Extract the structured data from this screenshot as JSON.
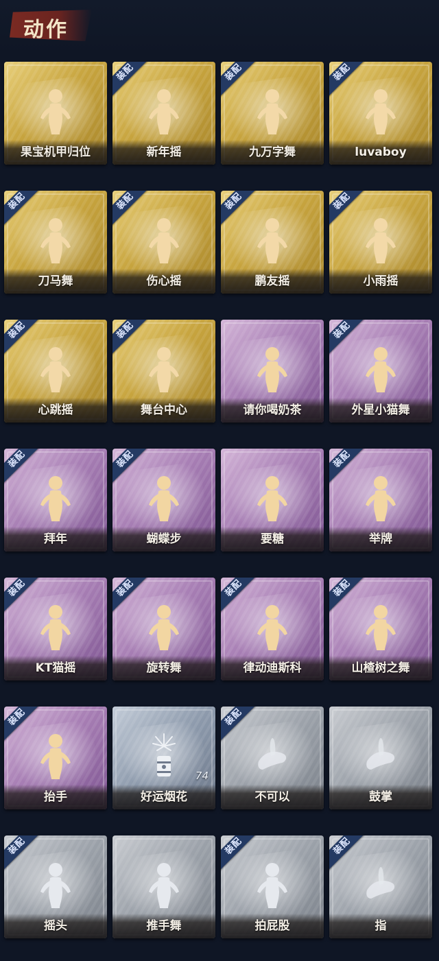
{
  "header": {
    "title": "动作"
  },
  "badge_text": "装配",
  "cards": [
    {
      "label": "果宝机甲归位",
      "tier": "gold",
      "equipped": false,
      "icon": "dance-figure-icon"
    },
    {
      "label": "新年摇",
      "tier": "gold",
      "equipped": true,
      "icon": "dance-figure-icon"
    },
    {
      "label": "九万字舞",
      "tier": "gold",
      "equipped": true,
      "icon": "dance-figure-icon"
    },
    {
      "label": "luvaboy",
      "tier": "gold",
      "equipped": true,
      "icon": "dance-figure-icon"
    },
    {
      "label": "刀马舞",
      "tier": "gold",
      "equipped": true,
      "icon": "dance-figure-icon"
    },
    {
      "label": "伤心摇",
      "tier": "gold",
      "equipped": true,
      "icon": "heart-hands-figure-icon"
    },
    {
      "label": "鹏友摇",
      "tier": "gold",
      "equipped": true,
      "icon": "dance-figure-icon"
    },
    {
      "label": "小雨摇",
      "tier": "gold",
      "equipped": true,
      "icon": "dance-figure-icon"
    },
    {
      "label": "心跳摇",
      "tier": "gold",
      "equipped": true,
      "icon": "dance-figure-icon"
    },
    {
      "label": "舞台中心",
      "tier": "gold",
      "equipped": true,
      "icon": "dance-figure-icon"
    },
    {
      "label": "请你喝奶茶",
      "tier": "purple",
      "equipped": false,
      "icon": "sign-figure-icon"
    },
    {
      "label": "外星小猫舞",
      "tier": "purple",
      "equipped": true,
      "icon": "dance-figure-icon"
    },
    {
      "label": "拜年",
      "tier": "purple",
      "equipped": true,
      "icon": "bow-figure-icon"
    },
    {
      "label": "蝴蝶步",
      "tier": "purple",
      "equipped": true,
      "icon": "dance-figure-icon"
    },
    {
      "label": "要糖",
      "tier": "purple",
      "equipped": false,
      "icon": "reach-figure-icon"
    },
    {
      "label": "举牌",
      "tier": "purple",
      "equipped": true,
      "icon": "sign-figure-icon"
    },
    {
      "label": "KT猫摇",
      "tier": "purple",
      "equipped": true,
      "icon": "dance-figure-icon"
    },
    {
      "label": "旋转舞",
      "tier": "purple",
      "equipped": true,
      "icon": "spin-figure-icon"
    },
    {
      "label": "律动迪斯科",
      "tier": "purple",
      "equipped": true,
      "icon": "disco-figure-icon"
    },
    {
      "label": "山楂树之舞",
      "tier": "purple",
      "equipped": true,
      "icon": "dance-figure-icon"
    },
    {
      "label": "抬手",
      "tier": "purple",
      "equipped": true,
      "icon": "raise-hand-figure-icon"
    },
    {
      "label": "好运烟花",
      "tier": "blue",
      "equipped": false,
      "icon": "firework-icon",
      "count": "74"
    },
    {
      "label": "不可以",
      "tier": "gray",
      "equipped": true,
      "icon": "finger-wag-icon"
    },
    {
      "label": "鼓掌",
      "tier": "gray",
      "equipped": false,
      "icon": "clap-hands-icon"
    },
    {
      "label": "摇头",
      "tier": "gray",
      "equipped": true,
      "icon": "head-shake-figure-icon"
    },
    {
      "label": "推手舞",
      "tier": "gray",
      "equipped": false,
      "icon": "push-hands-figure-icon"
    },
    {
      "label": "拍屁股",
      "tier": "gray",
      "equipped": true,
      "icon": "butt-slap-figure-icon"
    },
    {
      "label": "指",
      "tier": "gray",
      "equipped": true,
      "icon": "point-hand-icon"
    }
  ]
}
